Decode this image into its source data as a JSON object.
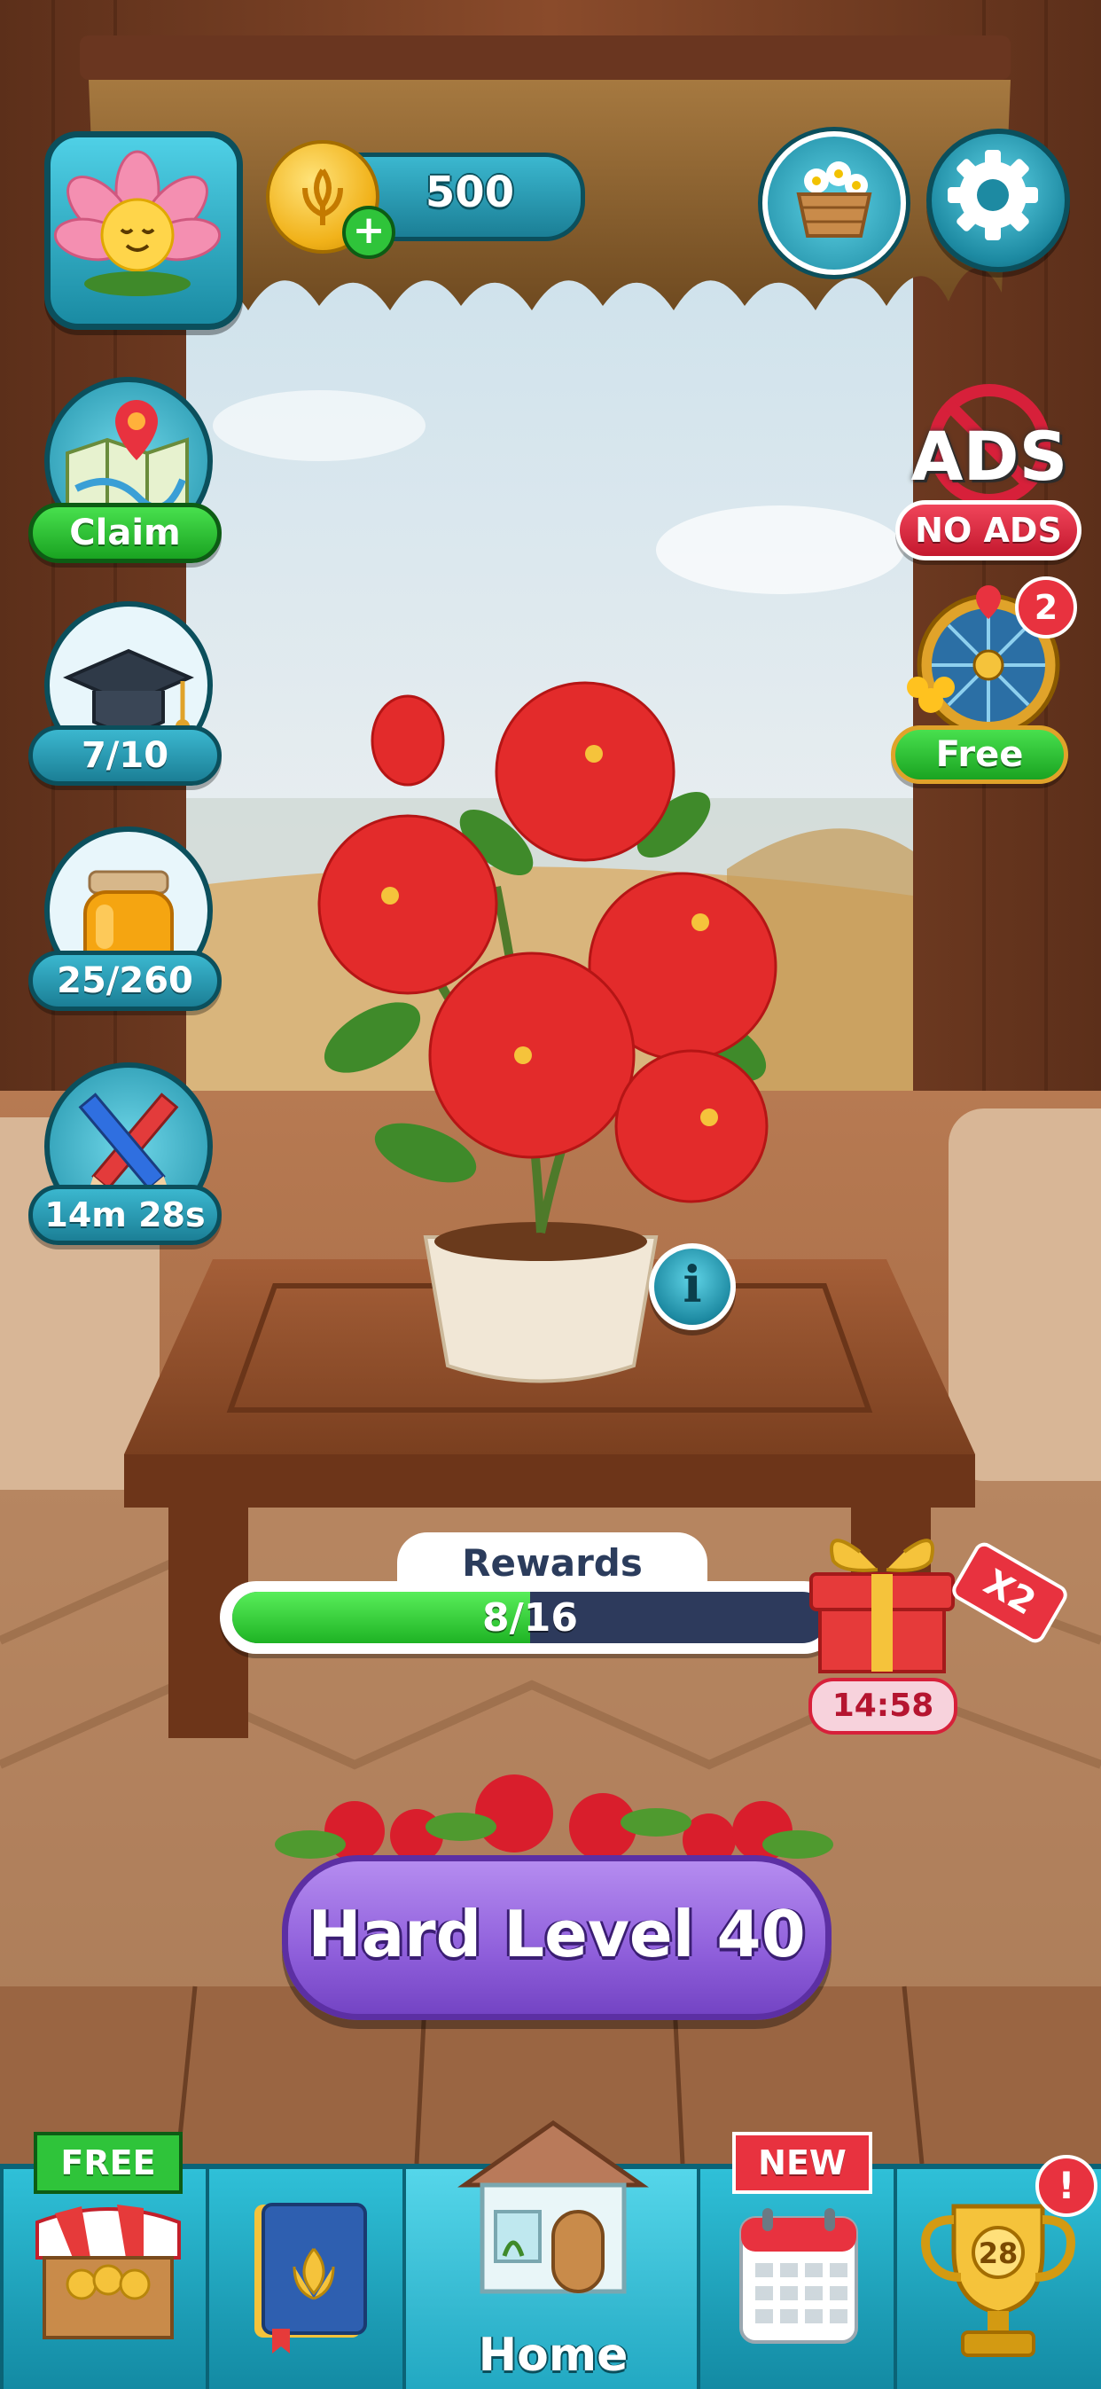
{
  "header": {
    "coins": "500"
  },
  "left_buttons": {
    "map_label": "Claim",
    "cap_label": "7/10",
    "honey_label": "25/260",
    "pencils_label": "14m 28s"
  },
  "right_buttons": {
    "ads_icon_text": "ADS",
    "no_ads_label": "NO ADS",
    "wheel_badge": "2",
    "wheel_label": "Free"
  },
  "rewards": {
    "title": "Rewards",
    "progress_text": "8/16",
    "progress_fraction": 0.5,
    "gift_tag": "X2",
    "timer": "14:58"
  },
  "play_button": {
    "label": "Hard Level 40"
  },
  "nav": {
    "shop_ribbon": "FREE",
    "calendar_ribbon": "NEW",
    "home_label": "Home",
    "trophy_number": "28",
    "trophy_badge": "!"
  },
  "icons": [
    "flower-avatar-icon",
    "coin-icon",
    "plus-icon",
    "basket-icon",
    "gear-icon",
    "map-icon",
    "graduation-cap-icon",
    "honey-jar-icon",
    "pencils-icon",
    "no-ads-icon",
    "wheel-icon",
    "info-icon",
    "gift-icon",
    "shop-icon",
    "book-icon",
    "house-icon",
    "calendar-icon",
    "trophy-icon"
  ],
  "colors": {
    "teal": "#1d8aa2",
    "green": "#1aa321",
    "red": "#d7203a",
    "purple": "#9b6be0",
    "progress_fill": "#2bd12e",
    "progress_track": "#2d3a5c"
  }
}
